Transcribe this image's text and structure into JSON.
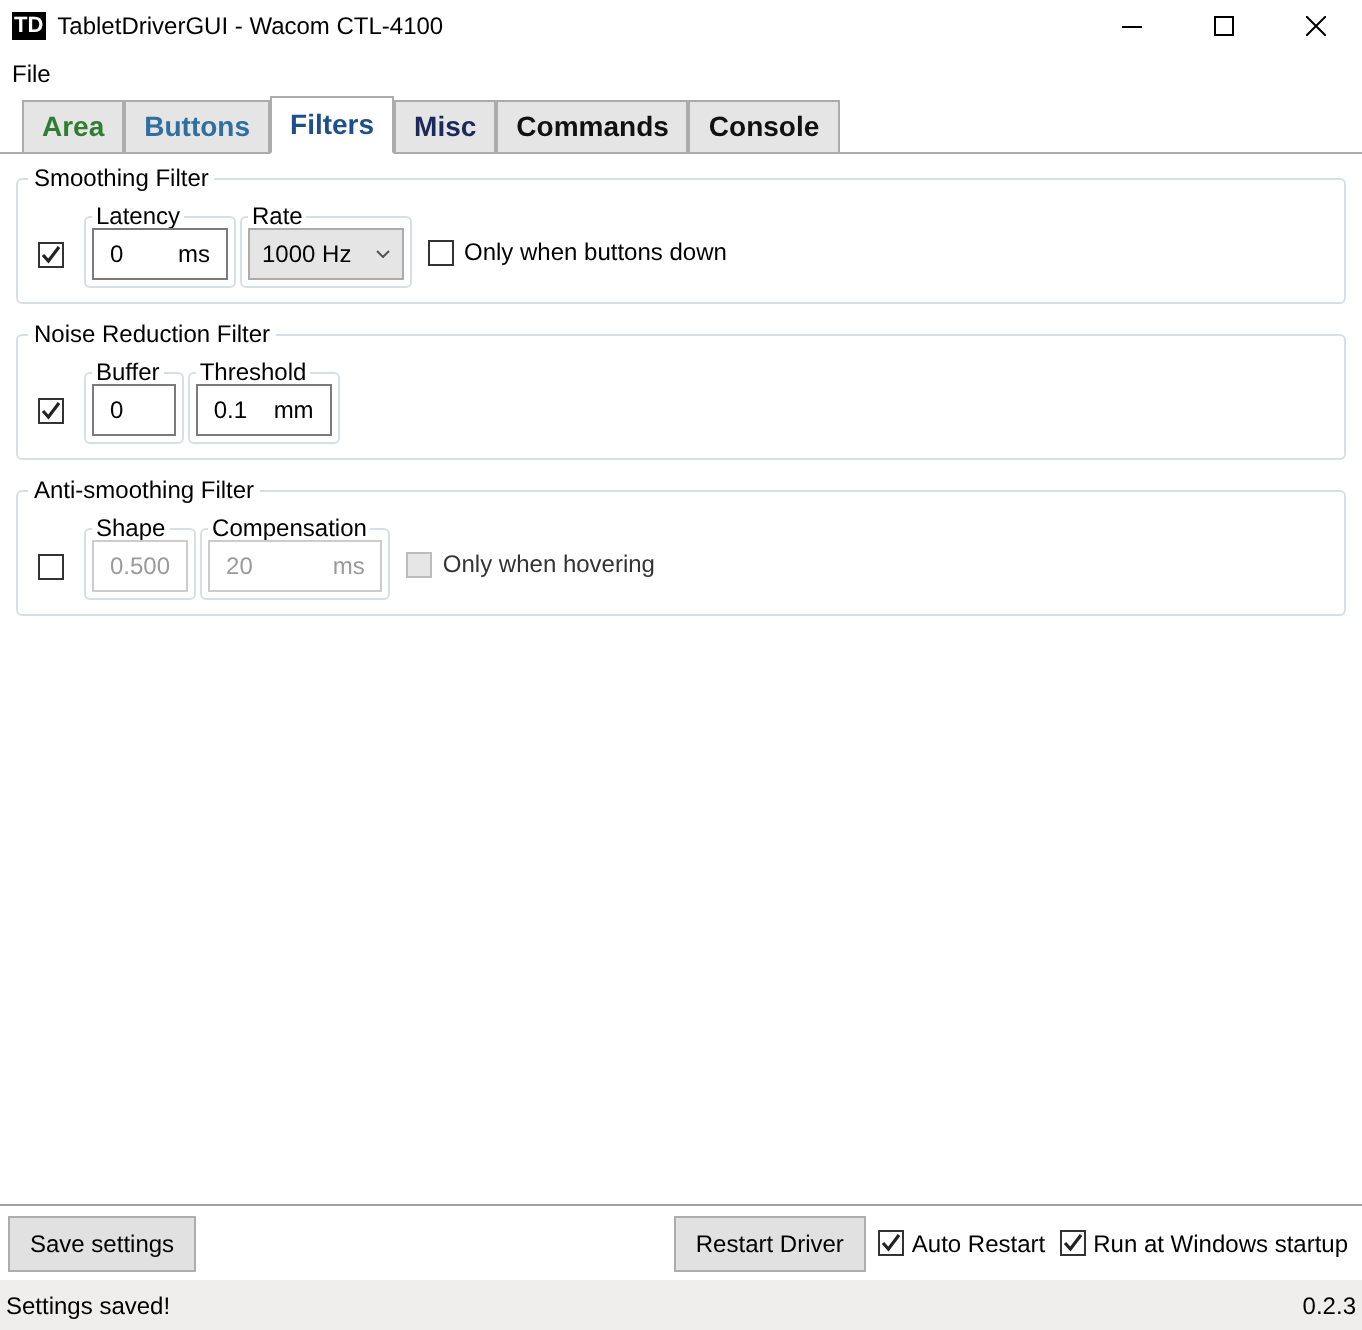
{
  "window": {
    "title": "TabletDriverGUI - Wacom CTL-4100",
    "app_icon": "TD"
  },
  "menu": [
    "File"
  ],
  "tabs": [
    {
      "label": "Area",
      "selected": false,
      "color": "#2e7d32"
    },
    {
      "label": "Buttons",
      "selected": false,
      "color": "#2f6e9e"
    },
    {
      "label": "Filters",
      "selected": true,
      "color": "#1f4e8c"
    },
    {
      "label": "Misc",
      "selected": false,
      "color": "#1c2a5a"
    },
    {
      "label": "Commands",
      "selected": false,
      "color": "#111111"
    },
    {
      "label": "Console",
      "selected": false,
      "color": "#111111"
    }
  ],
  "filters": [
    {
      "title": "Smoothing Filter",
      "enabled": true,
      "controls": [
        {
          "kind": "field",
          "label": "Latency",
          "value": "0",
          "unit": "ms",
          "disabled": false
        },
        {
          "kind": "select",
          "label": "Rate",
          "value": "1000 Hz",
          "disabled": false
        }
      ],
      "option": {
        "label": "Only when buttons down",
        "checked": false,
        "disabled": false
      }
    },
    {
      "title": "Noise Reduction Filter",
      "enabled": true,
      "controls": [
        {
          "kind": "field",
          "label": "Buffer",
          "value": "0",
          "disabled": false
        },
        {
          "kind": "field",
          "label": "Threshold",
          "value": "0.1",
          "unit": "mm",
          "disabled": false
        }
      ]
    },
    {
      "title": "Anti-smoothing Filter",
      "enabled": false,
      "controls": [
        {
          "kind": "field",
          "label": "Shape",
          "value": "0.500",
          "disabled": true
        },
        {
          "kind": "field",
          "label": "Compensation",
          "value": "20",
          "unit": "ms",
          "disabled": true
        }
      ],
      "option": {
        "label": "Only when hovering",
        "checked": false,
        "disabled": true
      }
    }
  ],
  "footer": {
    "save_button": "Save settings",
    "restart_button": "Restart Driver",
    "checkboxes": [
      {
        "label": "Auto Restart",
        "checked": true
      },
      {
        "label": "Run at Windows startup",
        "checked": true
      }
    ]
  },
  "status_bar": {
    "message": "Settings saved!",
    "version": "0.2.3"
  }
}
